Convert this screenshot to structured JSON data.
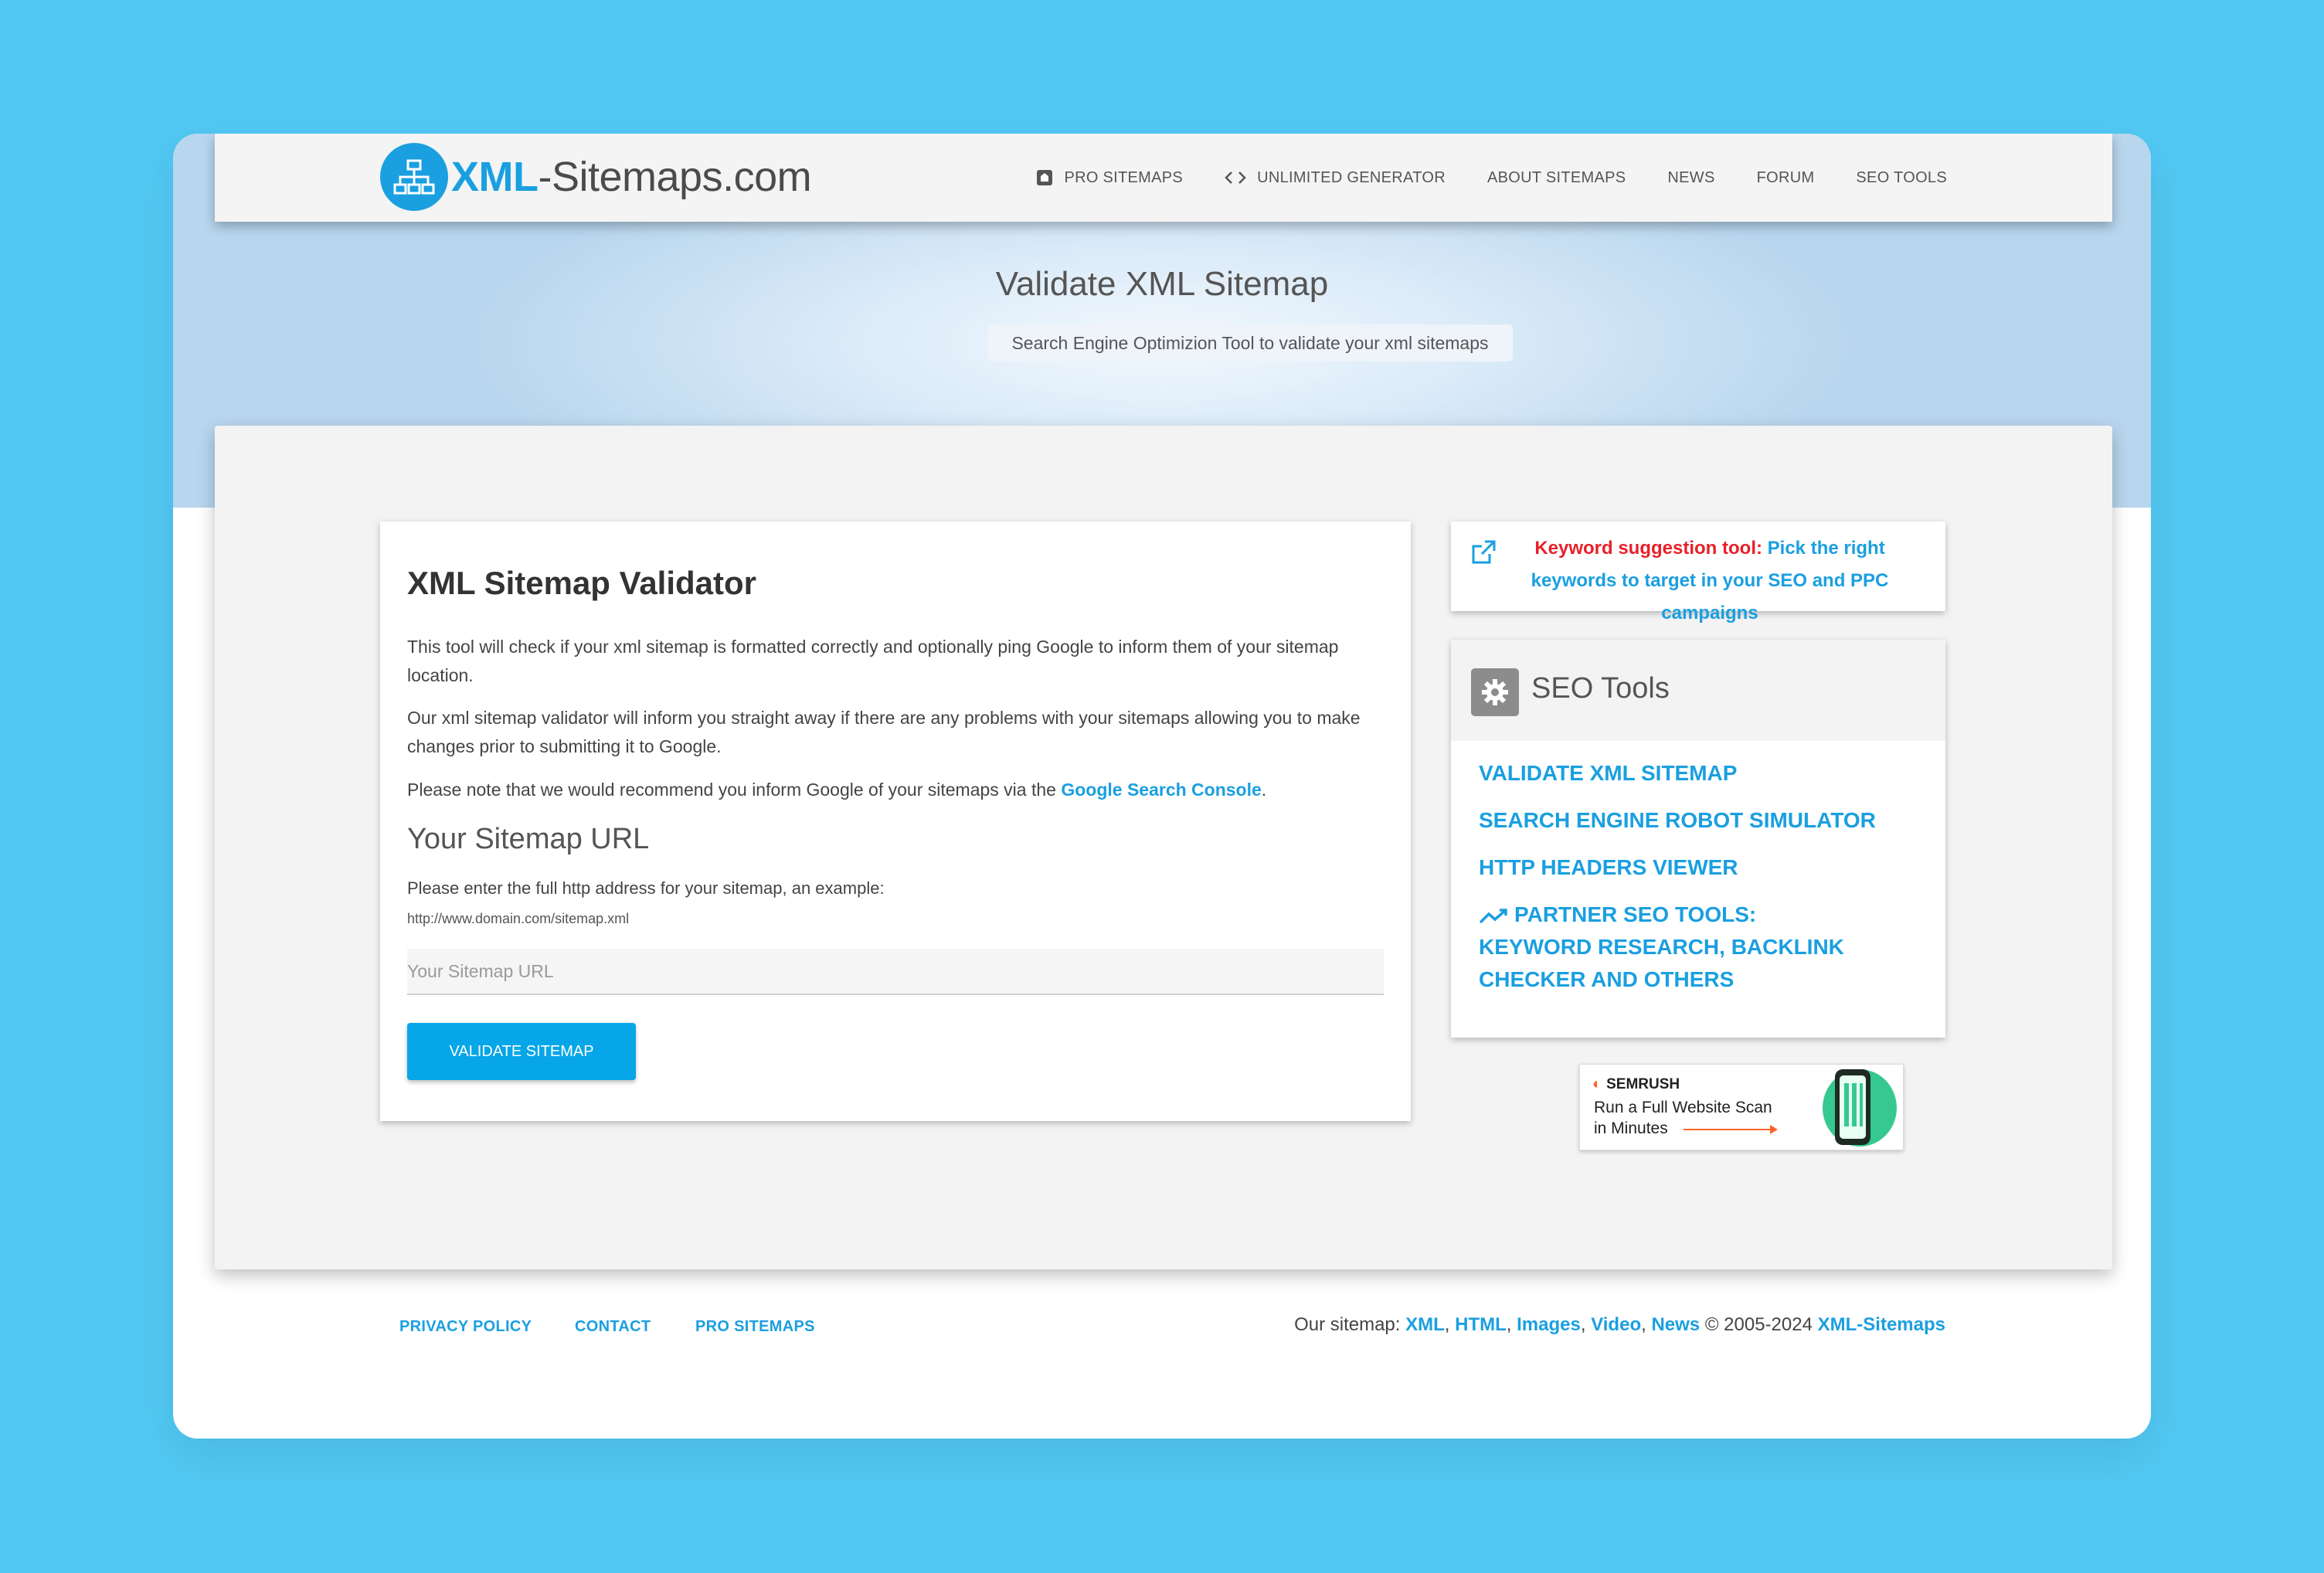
{
  "header": {
    "logo_brand": "XML",
    "logo_rest": "-Sitemaps.com",
    "nav": [
      {
        "label": "PRO SITEMAPS",
        "icon": "pro-icon"
      },
      {
        "label": "UNLIMITED GENERATOR",
        "icon": "code-icon"
      },
      {
        "label": "ABOUT SITEMAPS"
      },
      {
        "label": "NEWS"
      },
      {
        "label": "FORUM"
      },
      {
        "label": "SEO TOOLS"
      }
    ]
  },
  "hero": {
    "title": "Validate XML Sitemap",
    "subtitle": "Search Engine Optimizion Tool to validate your xml sitemaps"
  },
  "validator": {
    "title": "XML Sitemap Validator",
    "p1": "This tool will check if your xml sitemap is formatted correctly and optionally ping Google to inform them of your sitemap location.",
    "p2": "Our xml sitemap validator will inform you straight away if there are any problems with your sitemaps allowing you to make changes prior to submitting it to Google.",
    "p3_text": "Please note that we would recommend you inform Google of your sitemaps via the ",
    "p3_link": "Google Search Console",
    "p3_end": ".",
    "url_title": "Your Sitemap URL",
    "hint": "Please enter the full http address for your sitemap, an example:",
    "example": "http://www.domain.com/sitemap.xml",
    "input_placeholder": "Your Sitemap URL",
    "input_value": "",
    "button": "VALIDATE SITEMAP"
  },
  "keyword_box": {
    "label": "Keyword suggestion tool:",
    "text": "Pick the right keywords to target in your SEO and PPC campaigns"
  },
  "seo_tools": {
    "title": "SEO Tools",
    "links": [
      "VALIDATE XML SITEMAP",
      "SEARCH ENGINE ROBOT SIMULATOR",
      "HTTP HEADERS VIEWER"
    ],
    "partner_line1": "PARTNER SEO TOOLS:",
    "partner_line2": "KEYWORD RESEARCH, BACKLINK",
    "partner_line3": "CHECKER AND OTHERS"
  },
  "ad": {
    "brand": "SEMRUSH",
    "line1": "Run a Full Website Scan",
    "line2": "in Minutes"
  },
  "footer": {
    "links": [
      "PRIVACY POLICY",
      "CONTACT",
      "PRO SITEMAPS"
    ],
    "prefix": "Our sitemap: ",
    "sitemap_links": [
      "XML",
      "HTML",
      "Images",
      "Video",
      "News"
    ],
    "copyright": " © 2005-2024 ",
    "brand": "XML-Sitemaps"
  },
  "colors": {
    "background": "#51c8f3",
    "accent": "#1a9fe0",
    "button": "#06a6e8",
    "keyword_red": "#e8202a"
  }
}
